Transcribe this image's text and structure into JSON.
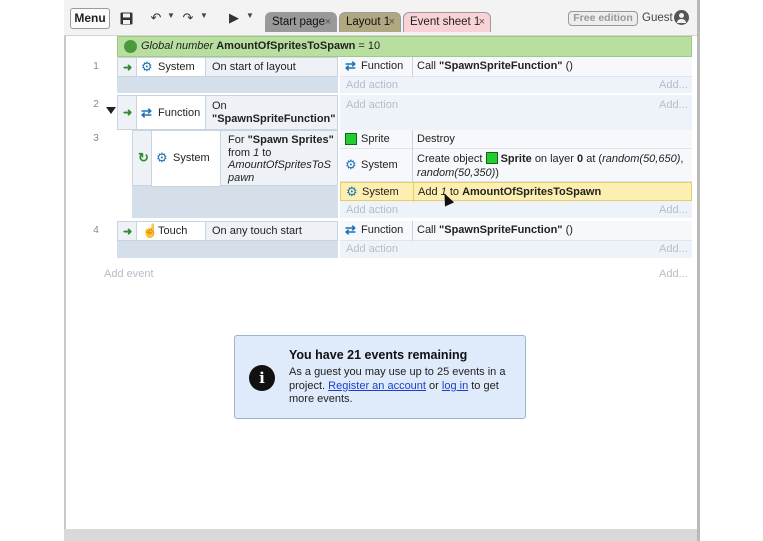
{
  "toolbar": {
    "menu_label": "Menu",
    "tabs": [
      {
        "label": "Start page"
      },
      {
        "label": "Layout 1"
      },
      {
        "label": "Event sheet 1"
      }
    ],
    "tab_close": "×",
    "free_edition": "Free edition",
    "guest": "Guest"
  },
  "global_var": {
    "prefix": "Global number",
    "name": "AmountOfSpritesToSpawn",
    "suffix": "= 10"
  },
  "events": [
    {
      "number": "1",
      "condition": {
        "object": "System",
        "text": "On start of layout"
      },
      "actions": [
        {
          "object": "Function",
          "text_prefix": "Call",
          "text_bold": "\"SpawnSpriteFunction\"",
          "text_suffix": "()"
        }
      ],
      "add_action": "Add action",
      "add_dots": "Add..."
    },
    {
      "number": "2",
      "condition": {
        "object": "Function",
        "text_line1": "On",
        "text_line2": "\"SpawnSpriteFunction\""
      },
      "add_action": "Add action",
      "add_dots": "Add..."
    },
    {
      "number": "3",
      "condition": {
        "object": "System",
        "text_a": "For",
        "text_b": "\"Spawn Sprites\"",
        "text_c": "from",
        "text_d": "1",
        "text_e": "to",
        "text_f": "AmountOfSpritesToS",
        "text_g": "pawn"
      },
      "actions": [
        {
          "object": "Sprite",
          "text": "Destroy"
        },
        {
          "object": "System",
          "text_a": "Create object",
          "text_b": "Sprite",
          "text_c": "on layer",
          "text_d": "0",
          "text_e": "at (",
          "text_f": "random(50,650)",
          "text_g": ",",
          "text_h": "random(50,350)",
          "text_i": ")"
        },
        {
          "object": "System",
          "text_a": "Add",
          "text_b": "1",
          "text_c": "to",
          "text_d": "AmountOfSpritesToSpawn"
        }
      ],
      "add_action": "Add action",
      "add_dots": "Add..."
    },
    {
      "number": "4",
      "condition": {
        "object": "Touch",
        "text": "On any touch start"
      },
      "actions": [
        {
          "object": "Function",
          "text_prefix": "Call",
          "text_bold": "\"SpawnSpriteFunction\"",
          "text_suffix": "()"
        }
      ],
      "add_action": "Add action",
      "add_dots": "Add..."
    }
  ],
  "add_event": "Add event",
  "add_event_dots": "Add...",
  "notice": {
    "title": "You have 21 events remaining",
    "body_a": "As a guest you may use up to 25 events in a project.",
    "register_link": "Register an account",
    "body_or": "or",
    "login_link": "log in",
    "body_b": "to get more events.",
    "icon": "i"
  },
  "colors": {
    "global_var_bg": "#b8dea0",
    "highlight_row": "#fdefb1",
    "notice_bg": "#dfeafb",
    "link": "#1a3fd0",
    "sprite_green": "#22cc33"
  }
}
